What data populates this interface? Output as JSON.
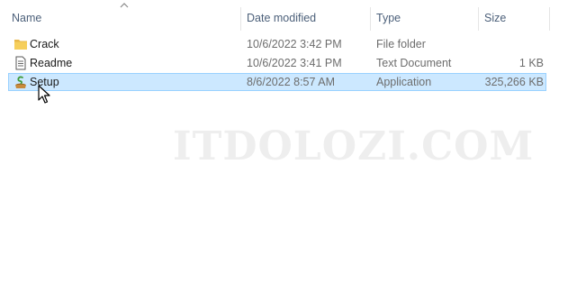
{
  "columns": {
    "name": "Name",
    "date_modified": "Date modified",
    "type": "Type",
    "size": "Size"
  },
  "sort": {
    "column": "name",
    "direction": "ascending",
    "icon": "chevron-up-icon"
  },
  "files": [
    {
      "name": "Crack",
      "date": "10/6/2022 3:42 PM",
      "type": "File folder",
      "size": "",
      "icon": "folder-icon",
      "selected": false
    },
    {
      "name": "Readme",
      "date": "10/6/2022 3:41 PM",
      "type": "Text Document",
      "size": "1 KB",
      "icon": "text-document-icon",
      "selected": false
    },
    {
      "name": "Setup",
      "date": "8/6/2022 8:57 AM",
      "type": "Application",
      "size": "325,266 KB",
      "icon": "setup-application-icon",
      "selected": true
    }
  ],
  "watermark": "ITDOLOZI.COM",
  "colors": {
    "selection_bg": "#cce8ff",
    "selection_border": "#99d1ff",
    "header_text": "#4c607a",
    "folder": "#e8b84a"
  }
}
